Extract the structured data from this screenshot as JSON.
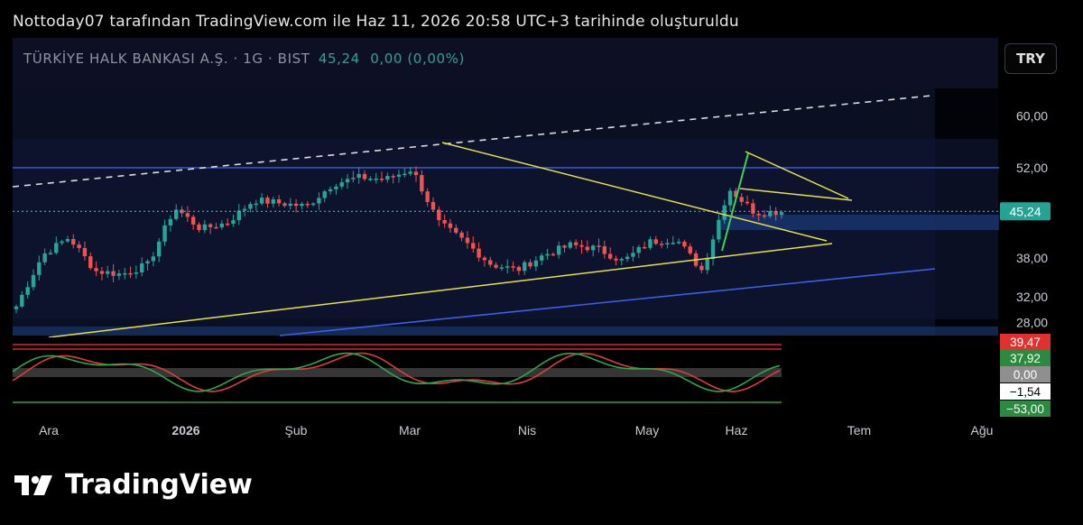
{
  "caption": "Nottoday07 tarafından TradingView.com ile Haz 11, 2026 20:58 UTC+3 tarihinde oluşturuldu",
  "symbol": {
    "name": "TÜRKİYE HALK BANKASI A.Ş. · 1G · BIST",
    "price": "45,24",
    "change": "0,00 (0,00%)"
  },
  "currency_button": "TRY",
  "brand": "TradingView",
  "colors": {
    "background": "#000000",
    "plot_bg": "#0a0f22",
    "up": "#26a69a",
    "down": "#ef5350",
    "trendline_yellow": "#e8e04a",
    "channel_blue": "#3d5ee8",
    "price_line": "#26a69a"
  },
  "chart_data": [
    {
      "type": "candlestick",
      "ylim": [
        26,
        64
      ],
      "y_ticks": [
        "60,00",
        "52,00",
        "45,24",
        "38,00",
        "32,00",
        "28,00"
      ],
      "x_ticks": [
        "Ara",
        "2026",
        "Şub",
        "Mar",
        "Nis",
        "May",
        "Haz",
        "Tem",
        "Ağu"
      ],
      "last_price_label": "45,24",
      "x": [
        "2025-11-24",
        "2025-12-01",
        "2025-12-08",
        "2025-12-15",
        "2025-12-22",
        "2025-12-29",
        "2026-01-05",
        "2026-01-12",
        "2026-01-19",
        "2026-01-26",
        "2026-02-02",
        "2026-02-09",
        "2026-02-16",
        "2026-02-23",
        "2026-03-02",
        "2026-03-09",
        "2026-03-16",
        "2026-03-23",
        "2026-03-30",
        "2026-04-06",
        "2026-04-13",
        "2026-04-20",
        "2026-04-27",
        "2026-05-04",
        "2026-05-11",
        "2026-05-18",
        "2026-05-25",
        "2026-06-01",
        "2026-06-08",
        "2026-06-11"
      ],
      "close": [
        30.5,
        38.5,
        41.2,
        36.0,
        35.5,
        37.0,
        45.8,
        42.5,
        43.5,
        47.0,
        46.5,
        46.0,
        49.5,
        50.5,
        50.2,
        51.8,
        43.5,
        40.5,
        37.0,
        36.2,
        38.5,
        40.0,
        39.5,
        37.5,
        40.5,
        41.0,
        36.0,
        48.8,
        45.0,
        45.24
      ],
      "annotations": [
        {
          "kind": "horizontal",
          "label": "52,00 resistance"
        },
        {
          "kind": "trendline",
          "label": "dashed upper trend"
        },
        {
          "kind": "triangle",
          "label": "yellow converging triangle"
        },
        {
          "kind": "flag",
          "label": "pennant near Haz"
        }
      ]
    },
    {
      "type": "line",
      "name": "oscillator",
      "value_labels": [
        "39,47",
        "37,92",
        "0,00",
        "−1,54",
        "−53,00"
      ]
    }
  ]
}
